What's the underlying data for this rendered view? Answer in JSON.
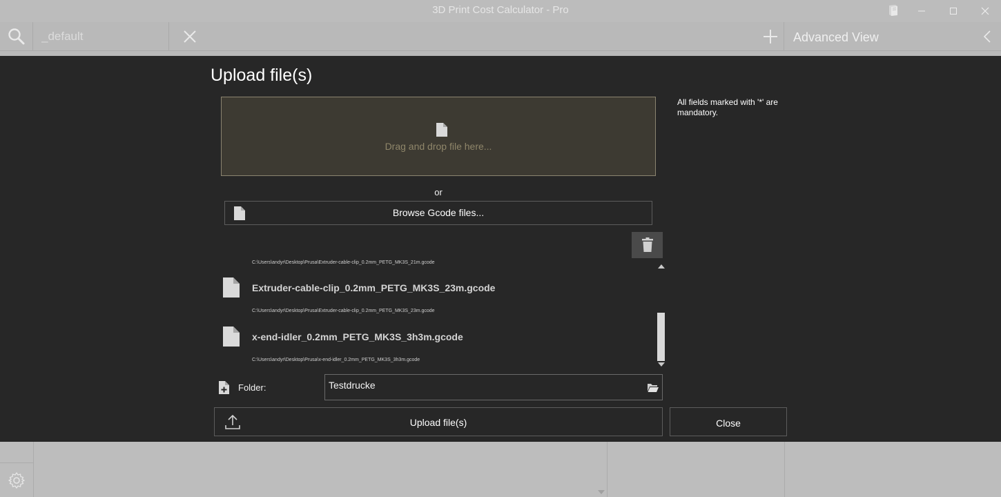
{
  "window": {
    "title": "3D Print Cost Calculator - Pro",
    "icons": [
      "book-icon",
      "minimize-icon",
      "maximize-icon",
      "close-icon"
    ]
  },
  "topbar": {
    "search_placeholder": "_default",
    "advanced_view_label": "Advanced View",
    "icons": [
      "search-icon",
      "clear-icon",
      "plus-icon",
      "chevron-left-icon"
    ]
  },
  "dialog": {
    "title": "Upload file(s)",
    "dropzone_text": "Drag and drop file here...",
    "or_text": "or",
    "browse_label": "Browse Gcode files...",
    "partial_path": "C:\\Users\\andyr\\Desktop\\Prusa\\Extruder-cable-clip_0.2mm_PETG_MK3S_21m.gcode",
    "files": [
      {
        "name": "Extruder-cable-clip_0.2mm_PETG_MK3S_23m.gcode",
        "path": "C:\\Users\\andyr\\Desktop\\Prusa\\Extruder-cable-clip_0.2mm_PETG_MK3S_23m.gcode"
      },
      {
        "name": "x-end-idler_0.2mm_PETG_MK3S_3h3m.gcode",
        "path": "C:\\Users\\andyr\\Desktop\\Prusa\\x-end-idler_0.2mm_PETG_MK3S_3h3m.gcode"
      }
    ],
    "folder_label": "Folder:",
    "folder_value": "Testdrucke",
    "upload_label": "Upload file(s)",
    "close_label": "Close",
    "mandatory_note": "All fields marked with '*' are mandatory."
  },
  "colors": {
    "overlay_bg": "#272727",
    "dropzone_bg": "#3d3a32",
    "dropzone_text": "#8f866a",
    "dimmed_app_bg": "#b9b9b9"
  }
}
